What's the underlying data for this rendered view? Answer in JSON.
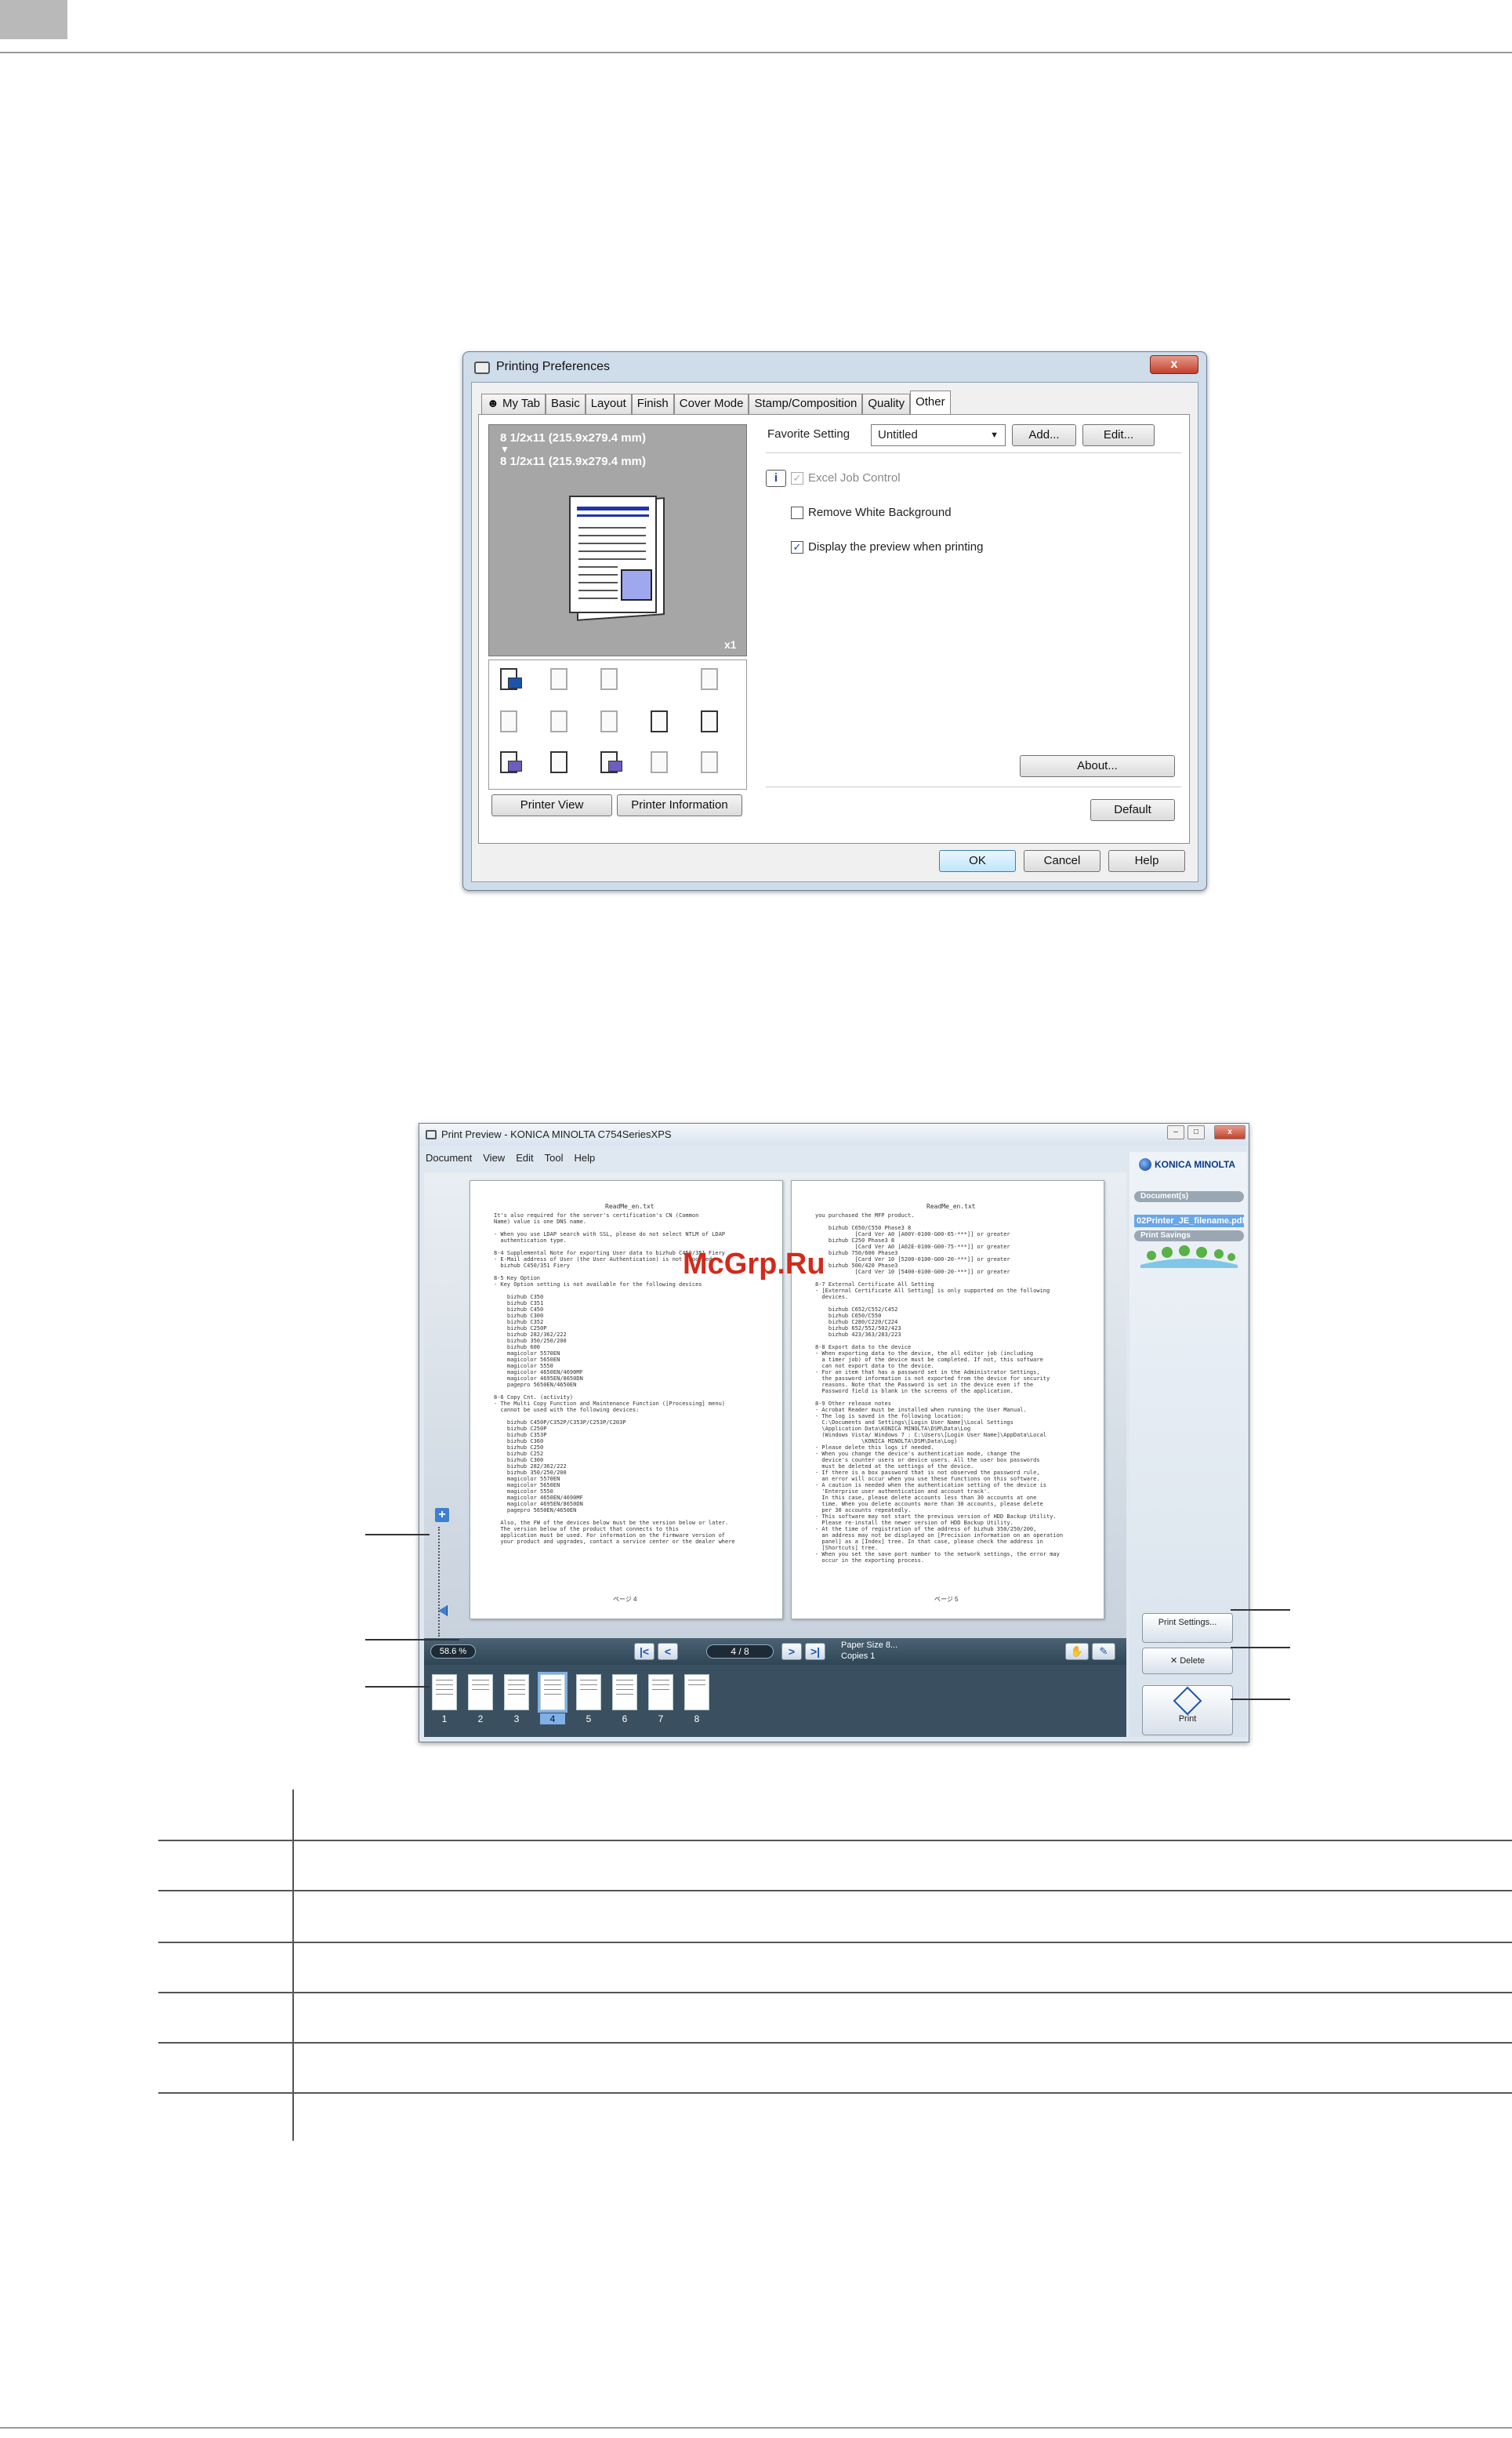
{
  "printing_preferences": {
    "title": "Printing Preferences",
    "close_label": "x",
    "tabs": [
      "My Tab",
      "Basic",
      "Layout",
      "Finish",
      "Cover Mode",
      "Stamp/Composition",
      "Quality",
      "Other"
    ],
    "active_tab": "Other",
    "preview": {
      "paper_line1": "8 1/2x11 (215.9x279.4 mm)",
      "arrow": "▼",
      "paper_line2": "8 1/2x11 (215.9x279.4 mm)",
      "copies": "x1"
    },
    "printer_view_label": "Printer View",
    "printer_information_label": "Printer Information",
    "favorite_setting_label": "Favorite Setting",
    "favorite_setting_value": "Untitled",
    "add_label": "Add...",
    "edit_label": "Edit...",
    "info_icon": "i",
    "options": {
      "excel_job_control": "Excel Job Control",
      "remove_white_background": "Remove White Background",
      "display_preview": "Display the preview when printing"
    },
    "check_mark": "✓",
    "about_label": "About...",
    "default_label": "Default",
    "ok_label": "OK",
    "cancel_label": "Cancel",
    "help_label": "Help"
  },
  "print_preview": {
    "title": "Print Preview - KONICA MINOLTA C754SeriesXPS",
    "window_controls": [
      "–",
      "□",
      "x"
    ],
    "menu": [
      "Document",
      "View",
      "Edit",
      "Tool",
      "Help"
    ],
    "watermark": "McGrp.Ru",
    "page_left": {
      "header": "ReadMe_en.txt",
      "footer": "ページ 4",
      "text": "It's also required for the server's certification's CN (Common\nName) value is one DNS name.\n\n- When you use LDAP search with SSL, please do not select NTLM of LDAP\n  authentication type.\n\n8-4 Supplemental Note for exporting User data to bizhub C450/351 Fiery\n- E-Mail address of User (the User Authentication) is not exported\n  bizhub C450/351 Fiery\n\n8-5 Key Option\n- Key Option setting is not available for the following devices\n\n    bizhub C350\n    bizhub C351\n    bizhub C450\n    bizhub C300\n    bizhub C352\n    bizhub C250P\n    bizhub 282/362/222\n    bizhub 350/250/200\n    bizhub 600\n    magicolor 5570EN\n    magicolor 5650EN\n    magicolor 5550\n    magicolor 4650EN/4690MF\n    magicolor 4695EN/8650DN\n    pagepro 5650EN/4650EN\n\n8-6 Copy Cnt. (activity)\n- The Multi Copy Function and Maintenance Function ([Processing] menu)\n  cannot be used with the following devices:\n\n    bizhub C450P/C352P/C353P/C253P/C203P\n    bizhub C250P\n    bizhub C353P\n    bizhub C360\n    bizhub C250\n    bizhub C252\n    bizhub C300\n    bizhub 282/362/222\n    bizhub 350/250/200\n    magicolor 5570EN\n    magicolor 5650EN\n    magicolor 5550\n    magicolor 4650EN/4690MF\n    magicolor 4695EN/8650DN\n    pagepro 5650EN/4650EN\n\n  Also, the FW of the devices below must be the version below or later.\n  The version below of the product that connects to this\n  application must be used. For information on the firmware version of\n  your product and upgrades, contact a service center or the dealer where"
    },
    "page_right": {
      "header": "ReadMe_en.txt",
      "footer": "ページ 5",
      "text": "you purchased the MFP product.\n\n    bizhub C650/C550 Phase3 8\n            [Card Ver A0 [A00Y-0100-G00-65-***]] or greater\n    bizhub C250 Phase3 8\n            [Card Ver A0 [A02E-0100-G00-75-***]] or greater\n    bizhub 750/600 Phase3\n            [Card Ver 10 [5200-0100-G00-20-***]] or greater\n    bizhub 500/420 Phase3\n            [Card Ver 10 [5400-0100-G00-20-***]] or greater\n\n8-7 External Certificate All Setting\n- [External Certificate All Setting] is only supported on the following\n  devices.\n\n    bizhub C652/C552/C452\n    bizhub C650/C550\n    bizhub C280/C220/C224\n    bizhub 652/552/502/423\n    bizhub 423/363/283/223\n\n8-8 Export data to the device\n- When exporting data to the device, the all editor job (including\n  a timer job) of the device must be completed. If not, this software\n  can not export data to the device.\n- For an item that has a password set in the Administrator Settings,\n  the password information is not exported from the device for security\n  reasons. Note that the Password is set in the device even if the\n  Password field is blank in the screens of the application.\n\n8-9 Other release notes\n- Acrobat Reader must be installed when running the User Manual.\n- The log is saved in the following location:\n  C:\\Documents and Settings\\[Login User Name]\\Local Settings\n  \\Application Data\\KONICA MINOLTA\\DSM\\Data\\Log\n  (Windows Vista/ Windows 7 : C:\\Users\\[Login User Name]\\AppData\\Local\n              \\KONICA MINOLTA\\DSM\\Data\\Log)\n- Please delete this logs if needed.\n- When you change the device's authentication mode, change the\n  device's counter users or device users. All the user box passwords\n  must be deleted at the settings of the device.\n- If there is a box password that is not observed the password rule,\n  an error will occur when you use these functions on this software.\n- A caution is needed when the authentication setting of the device is\n  'Enterprise user authentication and account track'.\n  In this case, please delete accounts less than 30 accounts at one\n  time. When you delete accounts more than 30 accounts, please delete\n  per 30 accounts repeatedly.\n- This software may not start the previous version of HDD Backup Utility.\n  Please re-install the newer version of HDD Backup Utility.\n- At the time of registration of the address of bizhub 350/250/200,\n  an address may not be displayed on [Precision information on an operation\n  panel] as a [Index] tree. In that case, please check the address in\n  [Shortcuts] tree.\n- When you set the save port number to the network settings, the error may\n  occur in the exporting process."
    },
    "zoom_plus": "+",
    "zoom_minus": "–",
    "zoom_readout": "58.6 %",
    "nav": {
      "first": "|<",
      "prev": "<",
      "next": ">",
      "last": ">|",
      "page_indicator": "4 / 8"
    },
    "paper_size": "Paper Size 8...",
    "copies": "Copies 1",
    "tool_icons": [
      "hand-icon",
      "pen-icon"
    ],
    "thumbnails": [
      "1",
      "2",
      "3",
      "4",
      "5",
      "6",
      "7",
      "8"
    ],
    "selected_page": 4,
    "side": {
      "brand": "KONICA MINOLTA",
      "documents_label": "Document(s)",
      "document_name": "02Printer_JE_filename.pdf",
      "print_savings_label": "Print Savings",
      "print_settings_label": "Print Settings...",
      "delete_label": "Delete",
      "print_label": "Print"
    }
  },
  "colors": {
    "dialog_frame": "#cfdcea",
    "accent_blue": "#1d54a8",
    "watermark_red": "#d12a1c",
    "status_bar": "#2f4656"
  }
}
